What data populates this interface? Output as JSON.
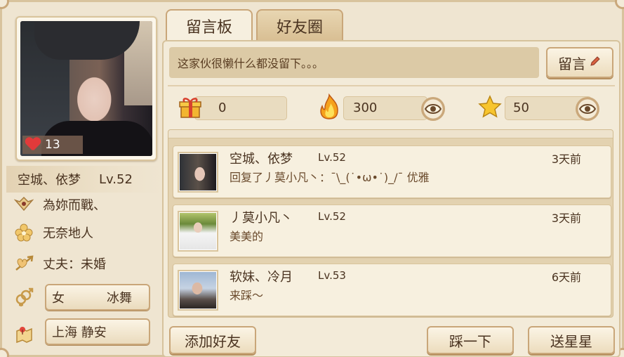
{
  "profile": {
    "like_count": "13",
    "nickname": "空城、依梦",
    "level": "Lv.52",
    "signature": "為妳而戰、",
    "location_tag": "无奈地人",
    "marital": "丈夫：未婚",
    "gender": "女",
    "constellation": "冰舞",
    "city": "上海 静安"
  },
  "tabs": [
    {
      "label": "留言板"
    },
    {
      "label": "好友圈"
    }
  ],
  "message_board": {
    "placeholder_text": "这家伙很懒什么都没留下。。。",
    "leave_message_label": "留言"
  },
  "stats": {
    "gifts": "0",
    "popularity": "300",
    "stars": "50"
  },
  "comments": [
    {
      "name": "空城、依梦",
      "level": "Lv.52",
      "time": "3天前",
      "text": "回复了丿莫小凡丶：¯\\_(˙•ω•˙)_/¯ 优雅"
    },
    {
      "name": "丿莫小凡丶",
      "level": "Lv.52",
      "time": "3天前",
      "text": "美美的"
    },
    {
      "name": "软妹、冷月",
      "level": "Lv.53",
      "time": "6天前",
      "text": "来踩～"
    }
  ],
  "actions": {
    "add_friend": "添加好友",
    "step": "踩一下",
    "send_star": "送星星"
  },
  "colors": {
    "panel_bg": "#efe5d1",
    "border": "#c9a679",
    "text": "#4a3320",
    "heart": "#e23a3a"
  }
}
